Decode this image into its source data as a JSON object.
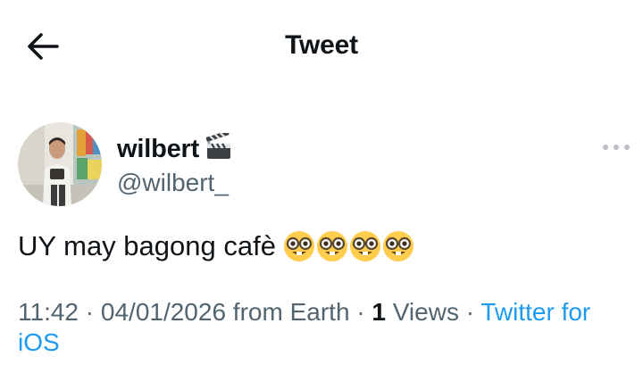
{
  "header": {
    "back_icon": "arrow-left-icon",
    "title": "Tweet"
  },
  "author": {
    "avatar_icon": "profile-photo",
    "display_name": "wilbert",
    "name_emoji": "clapper-board-icon",
    "handle": "@wilbert_",
    "more_icon": "more-horizontal-icon"
  },
  "tweet": {
    "text": "UY may bagong cafè",
    "emoji": [
      "nerd-face",
      "nerd-face",
      "nerd-face",
      "nerd-face"
    ]
  },
  "meta": {
    "time": "11:42",
    "sep1": " · ",
    "date": "04/01/2026",
    "location": " from Earth",
    "sep2": " · ",
    "views_count": "1",
    "views_label": " Views",
    "sep3": " · ",
    "source": "Twitter for iOS"
  },
  "colors": {
    "text_primary": "#0f1419",
    "text_secondary": "#536471",
    "link": "#1d9bf0"
  }
}
